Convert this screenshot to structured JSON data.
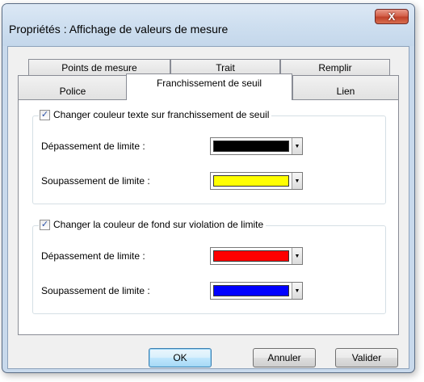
{
  "window": {
    "title": "Propriétés : Affichage de valeurs de mesure",
    "close_glyph": "X"
  },
  "tabs": {
    "back_row": [
      "Points de mesure",
      "Trait",
      "Remplir"
    ],
    "front_row": [
      "Police",
      "Franchissement de seuil",
      "Lien"
    ],
    "active": "Franchissement de seuil"
  },
  "groups": [
    {
      "checked": true,
      "title": "Changer couleur texte sur franchissement de seuil",
      "rows": [
        {
          "label": "Dépassement de limite :",
          "color": "#000000"
        },
        {
          "label": "Soupassement de limite :",
          "color": "#ffff00"
        }
      ]
    },
    {
      "checked": true,
      "title": "Changer la couleur de fond sur violation de limite",
      "rows": [
        {
          "label": "Dépassement de limite :",
          "color": "#ff0000"
        },
        {
          "label": "Soupassement de limite :",
          "color": "#0000ff"
        }
      ]
    }
  ],
  "buttons": {
    "ok": "OK",
    "cancel": "Annuler",
    "apply": "Valider"
  },
  "icons": {
    "checkbox_mark": "✓",
    "dropdown_arrow": "▼"
  }
}
